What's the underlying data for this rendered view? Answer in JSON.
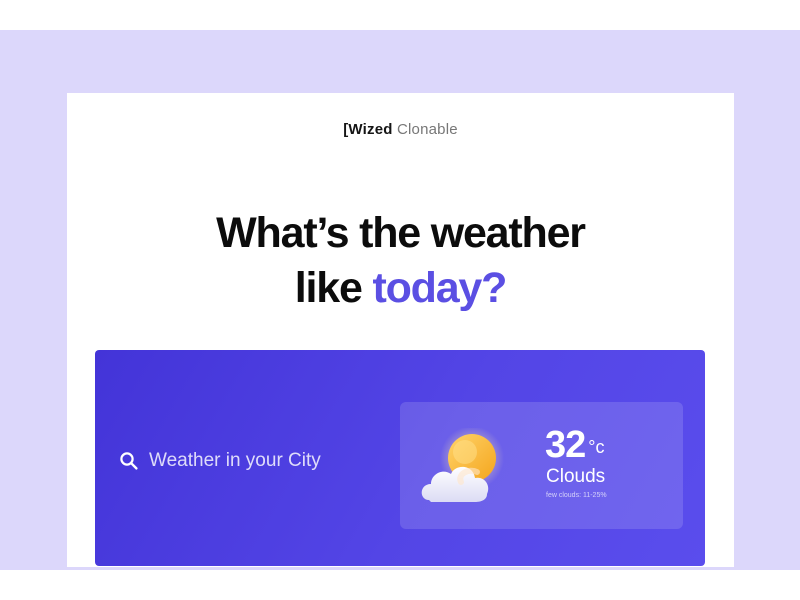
{
  "brand": {
    "mark": "[Wized",
    "name": "Clonable"
  },
  "headline": {
    "line1": "What’s the weather",
    "line2_plain": "like",
    "line2_accent": "today?"
  },
  "search": {
    "placeholder": "Weather in your City",
    "icon": "search-icon"
  },
  "weather": {
    "icon": "sun-behind-cloud-icon",
    "temperature": "32",
    "unit": "°c",
    "condition": "Clouds",
    "description": "few clouds: 11-25%"
  },
  "colors": {
    "background": "#dcd7fb",
    "accent": "#5b4fe3",
    "panel": "#4a3de0",
    "text_dark": "#0c0c0c"
  }
}
